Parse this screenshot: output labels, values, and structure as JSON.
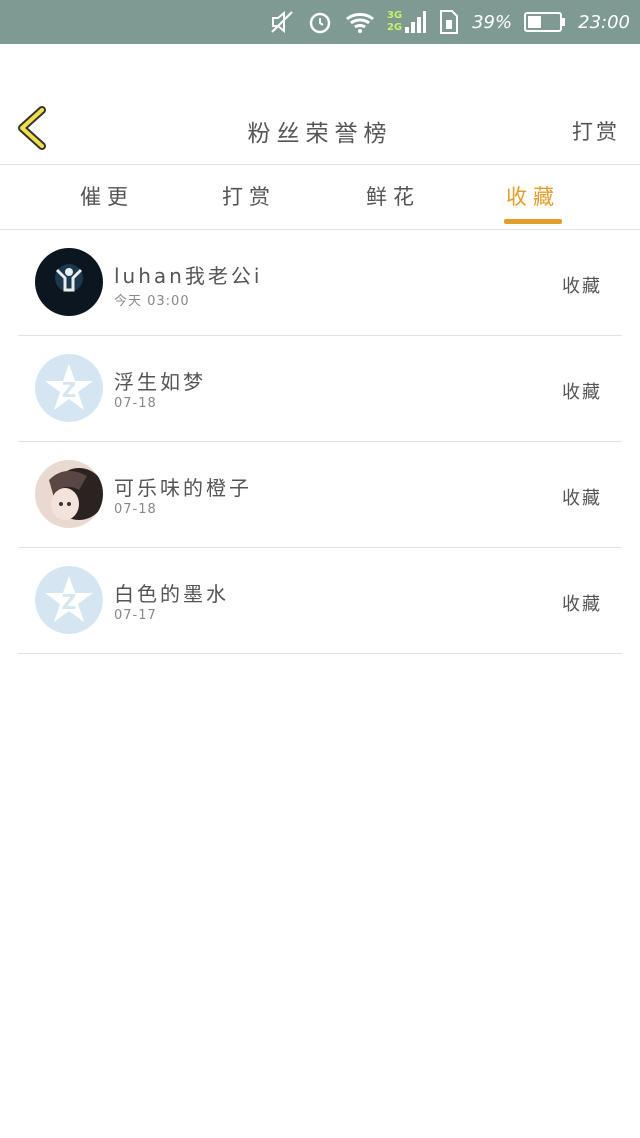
{
  "status_bar": {
    "network": "3G\n2G",
    "battery_percent": "39%",
    "time": "23:00",
    "icons": [
      "mute-icon",
      "alarm-icon",
      "wifi-icon",
      "signal-icon",
      "sim-icon",
      "battery-icon"
    ]
  },
  "header": {
    "title": "粉丝荣誉榜",
    "right_action": "打赏"
  },
  "tabs": [
    {
      "label": "催更"
    },
    {
      "label": "打赏"
    },
    {
      "label": "鲜花"
    },
    {
      "label": "收藏",
      "active": true
    }
  ],
  "items": [
    {
      "name": "luhan我老公i",
      "date": "今天 03:00",
      "action": "收藏",
      "avatar": "photo"
    },
    {
      "name": "浮生如梦",
      "date": "07-18",
      "action": "收藏",
      "avatar": "qq-default"
    },
    {
      "name": "可乐味的橙子",
      "date": "07-18",
      "action": "收藏",
      "avatar": "photo"
    },
    {
      "name": "白色的墨水",
      "date": "07-17",
      "action": "收藏",
      "avatar": "qq-default"
    }
  ],
  "colors": {
    "status_bar_bg": "#7f9a93",
    "accent": "#e1a02d"
  }
}
